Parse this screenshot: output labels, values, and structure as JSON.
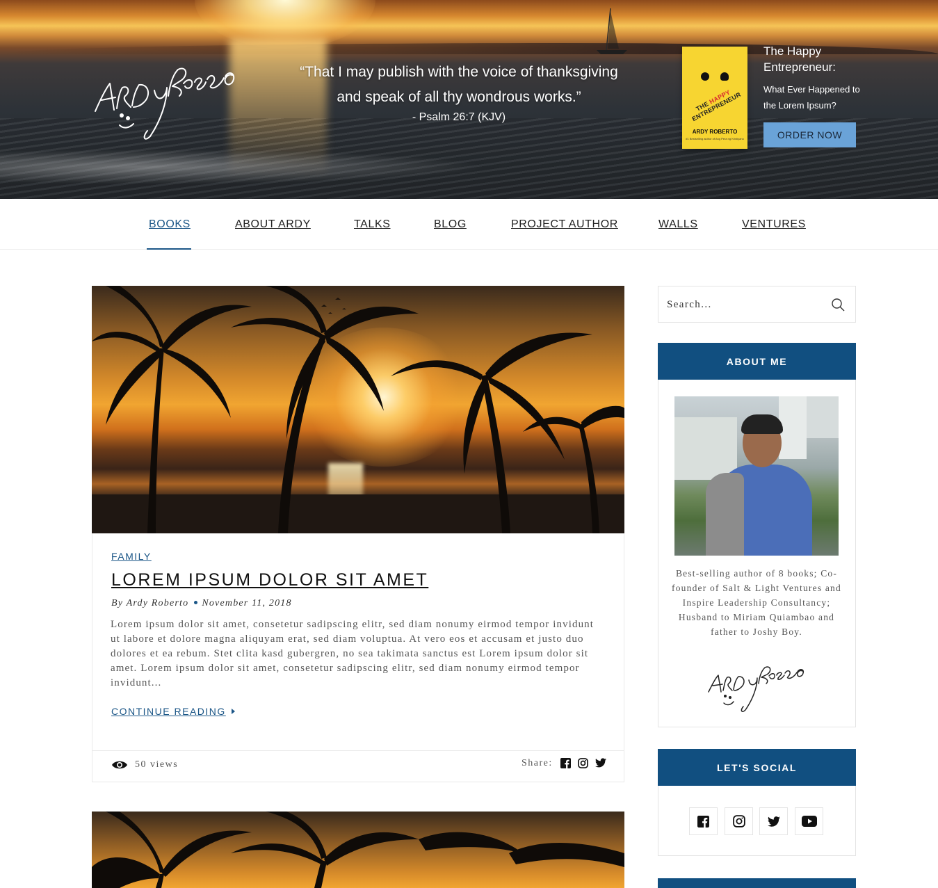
{
  "hero": {
    "quote_line1": "“That I may publish with the voice of thanksgiving",
    "quote_line2": "and speak of all thy wondrous works.”",
    "citation": "- Psalm 26:7 (KJV)",
    "book": {
      "cover_title_pre": "THE ",
      "cover_title_mid": "HAPPY",
      "cover_title_post": " ENTREPRENEUR",
      "cover_author": "ARDY ROBERTO",
      "title": "The Happy Entrepreneur:",
      "subtitle": "What Ever Happened to the Lorem Ipsum?",
      "order_label": "ORDER NOW"
    }
  },
  "nav": {
    "items": [
      {
        "label": "BOOKS"
      },
      {
        "label": "ABOUT ARDY"
      },
      {
        "label": "TALKS"
      },
      {
        "label": "BLOG"
      },
      {
        "label": "PROJECT AUTHOR"
      },
      {
        "label": "WALLS"
      },
      {
        "label": "VENTURES"
      }
    ],
    "active": "BOOKS"
  },
  "post": {
    "category": "FAMILY",
    "title": "LOREM IPSUM DOLOR SIT AMET",
    "author": "By Ardy Roberto",
    "date": "November 11, 2018",
    "excerpt": "Lorem ipsum dolor sit amet, consetetur sadipscing elitr, sed diam nonumy eirmod tempor invidunt ut labore et dolore magna aliquyam erat, sed diam voluptua. At vero eos et accusam et justo duo dolores et ea rebum. Stet clita kasd gubergren, no sea takimata sanctus est Lorem ipsum dolor sit amet. Lorem ipsum dolor sit amet, consetetur sadipscing elitr, sed diam nonumy eirmod tempor invidunt...",
    "continue_label": "CONTINUE READING",
    "views": "50 views",
    "share_label": "Share:",
    "share_icons": [
      "facebook-icon",
      "instagram-icon",
      "twitter-icon"
    ]
  },
  "sidebar": {
    "search": {
      "placeholder": "Search..."
    },
    "about": {
      "heading": "ABOUT ME",
      "bio": "Best-selling author of 8 books; Co-founder of Salt & Light Ventures and Inspire Leadership Consultancy; Husband to Miriam Quiambao and father to Joshy Boy."
    },
    "social": {
      "heading": "LET'S SOCIAL",
      "icons": [
        "facebook-icon",
        "instagram-icon",
        "twitter-icon",
        "youtube-icon"
      ]
    }
  },
  "colors": {
    "brand_blue": "#114f80",
    "accent_blue": "#1b5687",
    "order_button": "#6aa3d8",
    "book_yellow": "#f7d531"
  }
}
